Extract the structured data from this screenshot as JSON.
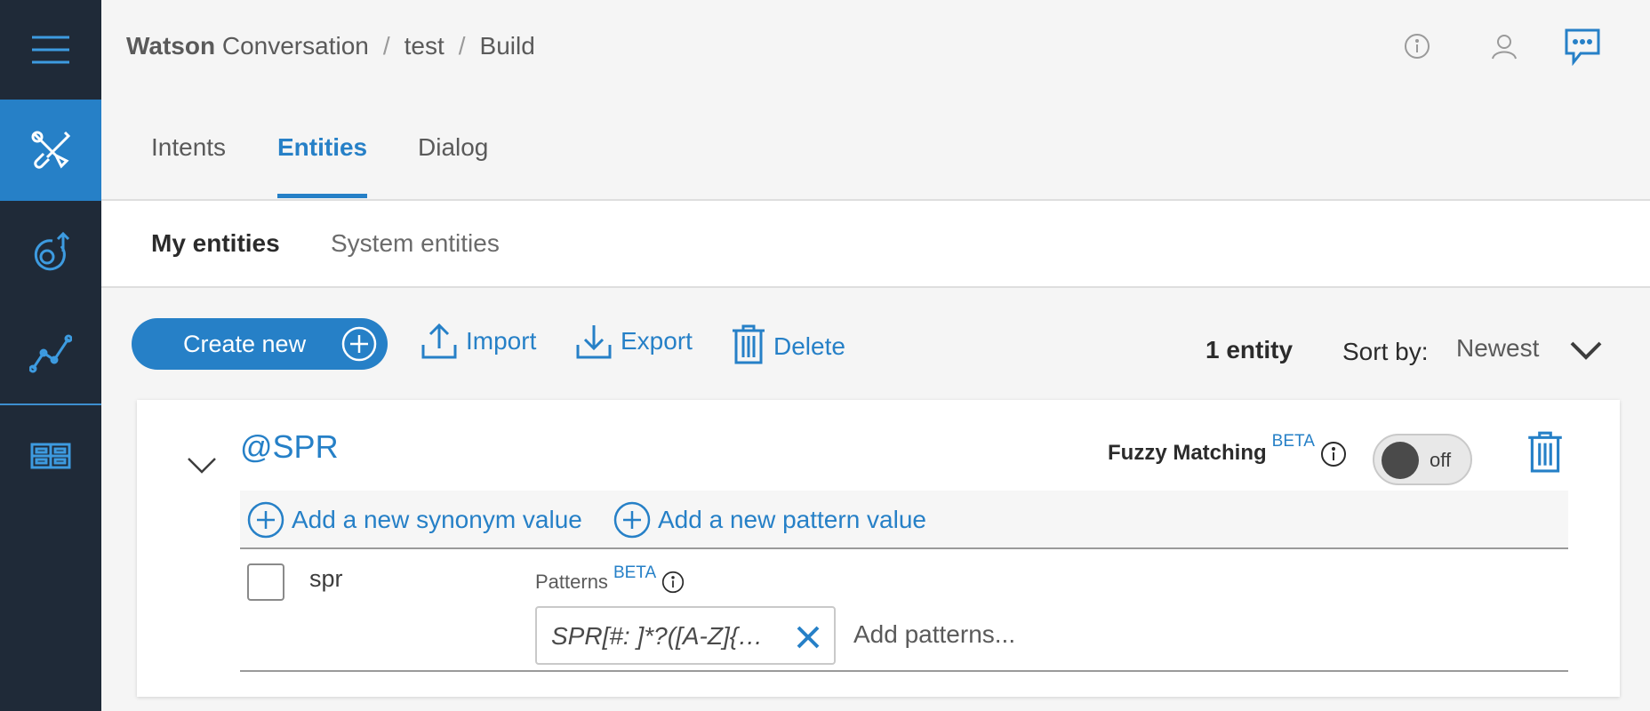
{
  "breadcrumb": {
    "brand": "Watson",
    "product": " Conversation",
    "sep1": "/",
    "workspace": "test",
    "sep2": "/",
    "page": "Build"
  },
  "header_icons": [
    "info-icon",
    "user-icon",
    "chat-icon"
  ],
  "sidebar": {
    "items": [
      "menu-icon",
      "build-tools-icon",
      "deploy-icon",
      "improve-chart-icon",
      "workspaces-icon"
    ]
  },
  "tabs": {
    "intents": "Intents",
    "entities": "Entities",
    "dialog": "Dialog",
    "active": "Entities"
  },
  "subtabs": {
    "my": "My entities",
    "system": "System entities",
    "active": "My entities"
  },
  "toolbar": {
    "create": "Create new",
    "import": "Import",
    "export": "Export",
    "delete": "Delete",
    "count": "1 entity",
    "sort_label": "Sort by:",
    "sort_value": "Newest"
  },
  "entity": {
    "name": "@SPR",
    "fuzzy_label": "Fuzzy Matching",
    "beta": "BETA",
    "toggle_state": "off",
    "add_synonym": "Add a new synonym value",
    "add_pattern": "Add a new pattern value",
    "values": [
      {
        "name": "spr",
        "patterns_label": "Patterns",
        "patterns_beta": "BETA",
        "pattern": "SPR[#: ]*?([A-Z]{…",
        "add_placeholder": "Add patterns..."
      }
    ]
  },
  "colors": {
    "sidebar": "#1f2a38",
    "accent": "#2680c7",
    "background": "#f5f5f5"
  }
}
